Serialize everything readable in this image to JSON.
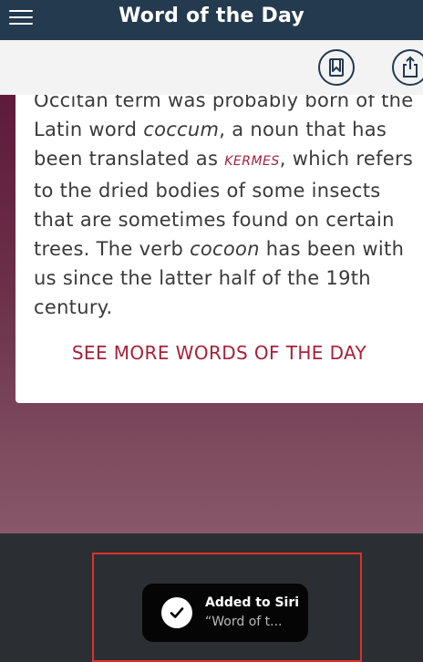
{
  "app": {
    "title": "Word of the Day"
  },
  "toolbar": {
    "bookmark_icon": "bookmark-icon",
    "share_icon": "share-icon"
  },
  "article": {
    "line1": "Occitan term was probably born of the",
    "line2_pre": "Latin word ",
    "line2_em": "coccum",
    "line2_post": ", a noun that has",
    "line3_pre": "been translated as ",
    "line3_caps": "KERMES",
    "line3_post": ", which refers",
    "line4": "to the dried bodies of some insects",
    "line5": "that are sometimes found on certain",
    "line6_pre": "trees. The verb ",
    "line6_em": "cocoon",
    "line6_post": " has been with",
    "line7": "us since the latter half of the 19th",
    "line8": "century.",
    "see_more": "SEE MORE WORDS OF THE DAY"
  },
  "siri_toast": {
    "title": "Added to Siri",
    "subtitle": "“Word of t..."
  },
  "colors": {
    "navbar": "#243a4f",
    "accent": "#a6213a",
    "highlight": "#e0302a"
  }
}
